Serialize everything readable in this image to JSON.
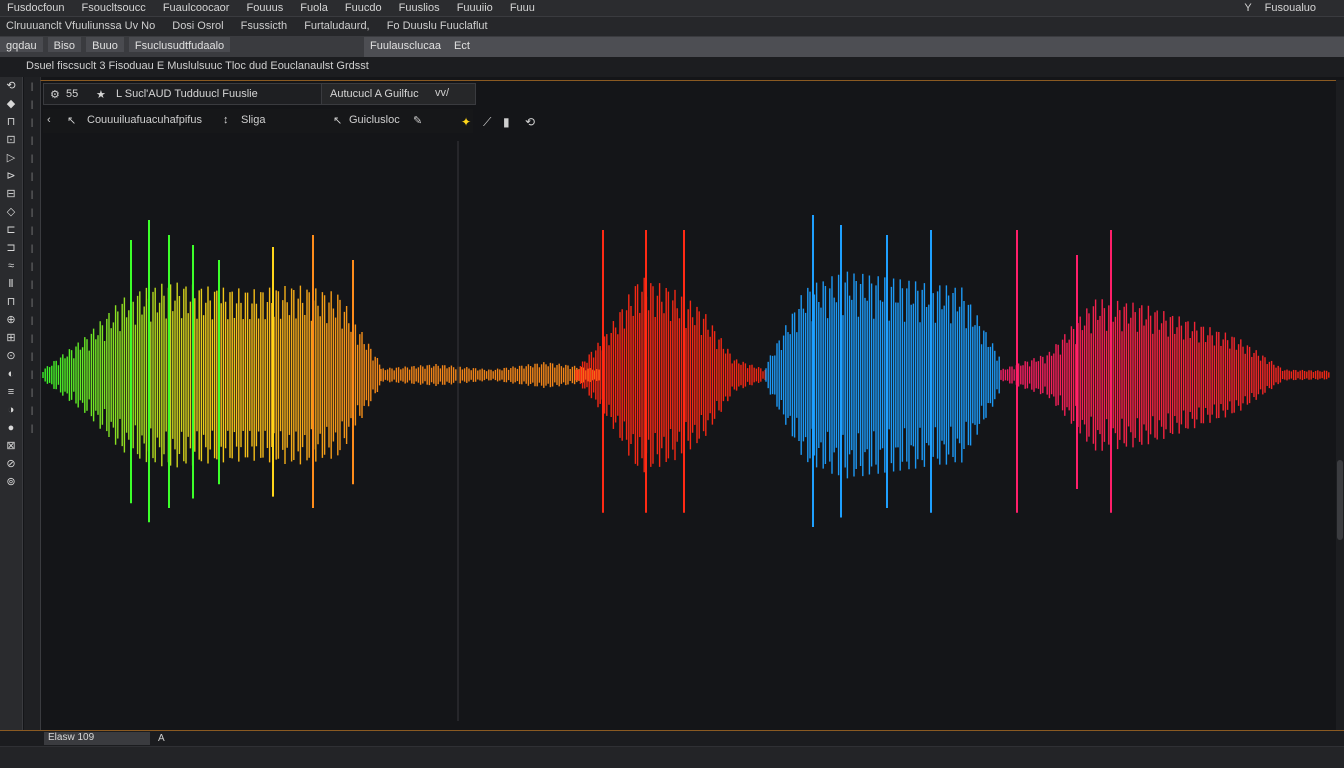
{
  "menubar": {
    "items": [
      "Fusdocfoun",
      "Fsoucltsoucc",
      "Fuaulcoocaor",
      "Fouuus",
      "Fuola",
      "Fuucdo",
      "Fuuslios",
      "Fuuuiio",
      "Fuuu"
    ],
    "right_items": [
      "Y",
      "Fusoualuo"
    ]
  },
  "toolbar1": {
    "items": [
      "Clruuuanclt Vfuuliunssa Uv No",
      "Dosi Osrol",
      "Fsussicth",
      "Furtaludaurd,",
      "Fo Duuslu Fuuclaflut"
    ]
  },
  "toolbar2": {
    "items": [
      "gqdau",
      "Biso",
      "Buuo",
      "Fsuclusudtfudaalo"
    ],
    "right_items": [
      "Fuulausclucaa",
      "Ect"
    ]
  },
  "tabstrip": {
    "label": "Dsuel fiscsuclt 3  Fisoduau E Muslulsuuc  Tloc dud Eouclanaulst Grdsst"
  },
  "leftrail": {
    "icons": [
      "tool-1",
      "tool-2",
      "tool-3",
      "tool-4",
      "tool-5",
      "tool-6",
      "tool-7",
      "tool-8",
      "tool-9",
      "tool-10",
      "tool-11",
      "tool-12",
      "tool-13",
      "tool-14",
      "tool-15",
      "tool-16",
      "tool-17",
      "tool-18",
      "tool-19",
      "tool-20",
      "tool-21",
      "tool-22",
      "tool-23"
    ],
    "glyphs": [
      "⟲",
      "◆",
      "⊓",
      "⊡",
      "▷",
      "⊳",
      "⊟",
      "◇",
      "⊏",
      "⊐",
      "≈",
      "Ⅱ",
      "⊓",
      "⊕",
      "⊞",
      "⊙",
      "◐",
      "≡",
      "◑",
      "●",
      "⊠",
      "⊘",
      "⊚"
    ]
  },
  "panel": {
    "head_left_icon": "settings-icon",
    "head_number": "55",
    "head_title": "L Sucl'AUD Tudduucl Fuuslie",
    "head_right": "Autucucl A Guilfuc",
    "tools_label": "Couuuiluafuacuhafpifus",
    "tools_label2": "Sliga",
    "tools_label3": "Guiclusloc",
    "head_extra": "vv/"
  },
  "status": {
    "field_value": "Elasw 109",
    "arrow": "A"
  },
  "colors": {
    "accent_orange": "#8a5a22",
    "segment_green": "#3cff2a",
    "segment_yellow": "#ffd61a",
    "segment_orange": "#ff8c1a",
    "segment_red": "#ff2a14",
    "segment_blue": "#1ea0ff",
    "segment_pink": "#ff1f6a"
  },
  "chart_data": {
    "type": "line",
    "title": "",
    "xlabel": "",
    "ylabel": "",
    "series": [
      {
        "values": [
          0.05,
          0.45,
          0.9,
          0.95,
          0.85,
          0.2
        ]
      },
      {
        "values": [
          0.05,
          0.15,
          0.05,
          0.1
        ]
      },
      {
        "values": [
          0.05,
          0.9,
          0.85,
          0.6,
          0.1
        ]
      },
      {
        "values": [
          0.1,
          0.95,
          0.9,
          0.85,
          0.15
        ]
      },
      {
        "values": [
          0.05,
          0.4,
          0.9,
          0.6,
          0.05
        ]
      }
    ]
  }
}
